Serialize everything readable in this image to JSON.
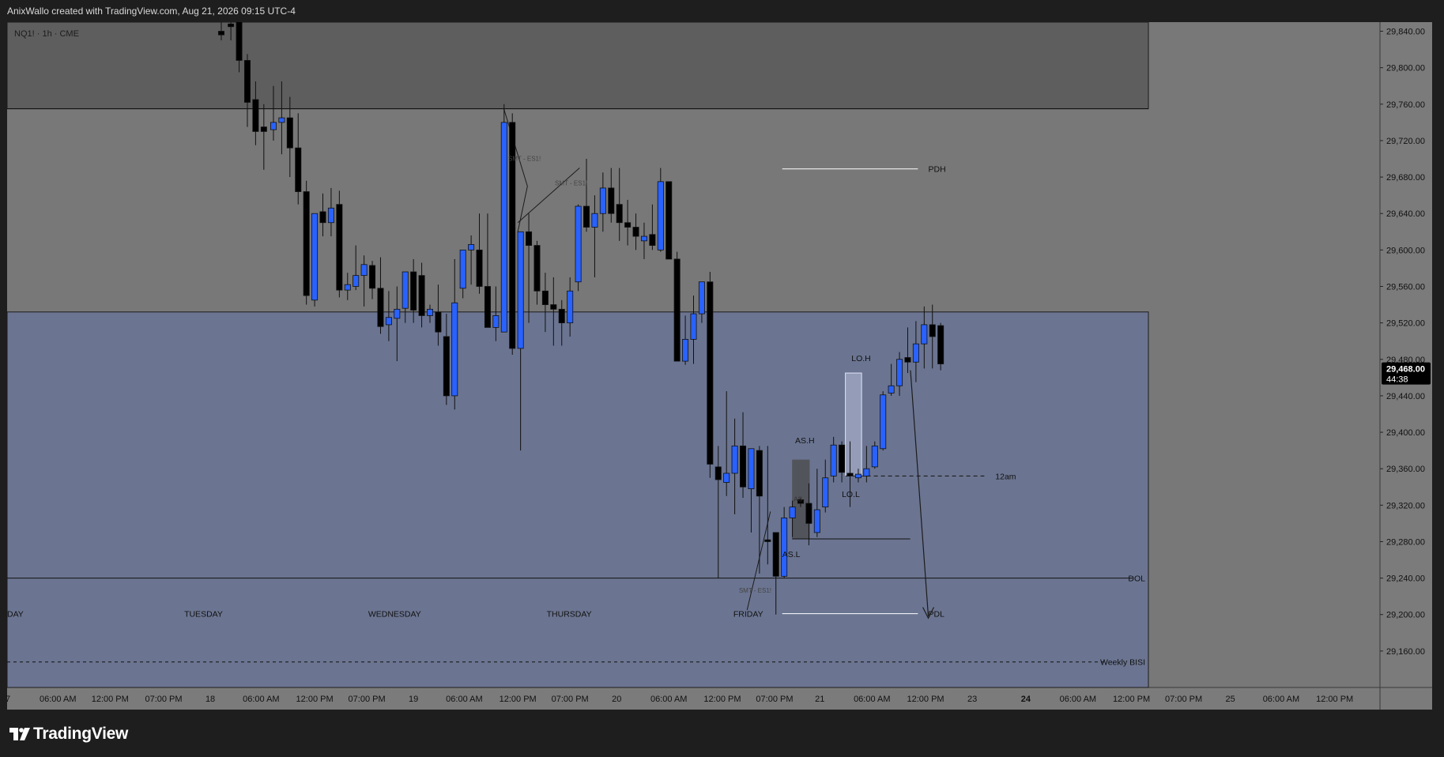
{
  "header": {
    "caption": "AnixWallo created with TradingView.com, Aug 21, 2026 09:15 UTC-4"
  },
  "symbol": "NQ1! · 1h · CME",
  "footer": {
    "brand": "TradingView"
  },
  "colors": {
    "bg": "#787878",
    "premium_zone": "#5e5e5e",
    "discount_zone": "#6b7591",
    "bull": "#2962ff",
    "bear": "#000000",
    "axis_bg": "#7b7b7b",
    "frame": "#1e1e1e"
  },
  "chart_data": {
    "type": "candlestick",
    "instrument": "NQ1!",
    "timeframe": "1h",
    "exchange": "CME",
    "ylim": [
      29120,
      29850
    ],
    "y_ticks": [
      29160,
      29200,
      29240,
      29280,
      29320,
      29360,
      29400,
      29440,
      29480,
      29520,
      29560,
      29600,
      29640,
      29680,
      29720,
      29760,
      29800,
      29840
    ],
    "y_tick_labels": [
      "29,160.00",
      "29,200.00",
      "29,240.00",
      "29,280.00",
      "29,320.00",
      "29,360.00",
      "29,400.00",
      "29,440.00",
      "29,480.00",
      "29,520.00",
      "29,560.00",
      "29,600.00",
      "29,640.00",
      "29,680.00",
      "29,720.00",
      "29,760.00",
      "29,800.00",
      "29,840.00"
    ],
    "x_ticks": [
      {
        "label": "06:00 AM",
        "x": 0.037
      },
      {
        "label": "12:00 PM",
        "x": 0.075
      },
      {
        "label": "07:00 PM",
        "x": 0.114
      },
      {
        "label": "18",
        "x": 0.148
      },
      {
        "label": "06:00 AM",
        "x": 0.185
      },
      {
        "label": "12:00 PM",
        "x": 0.224
      },
      {
        "label": "07:00 PM",
        "x": 0.262
      },
      {
        "label": "19",
        "x": 0.296
      },
      {
        "label": "06:00 AM",
        "x": 0.333
      },
      {
        "label": "12:00 PM",
        "x": 0.372
      },
      {
        "label": "07:00 PM",
        "x": 0.41
      },
      {
        "label": "20",
        "x": 0.444
      },
      {
        "label": "06:00 AM",
        "x": 0.482
      },
      {
        "label": "12:00 PM",
        "x": 0.521
      },
      {
        "label": "07:00 PM",
        "x": 0.559
      },
      {
        "label": "21",
        "x": 0.592
      },
      {
        "label": "06:00 AM",
        "x": 0.63
      },
      {
        "label": "12:00 PM",
        "x": 0.669
      },
      {
        "label": "23",
        "x": 0.703
      },
      {
        "label": "24",
        "x": 0.742
      },
      {
        "label": "06:00 AM",
        "x": 0.78
      },
      {
        "label": "12:00 PM",
        "x": 0.819
      },
      {
        "label": "07:00 PM",
        "x": 0.857
      },
      {
        "label": "25",
        "x": 0.891
      },
      {
        "label": "06:00 AM",
        "x": 0.928
      },
      {
        "label": "12:00 PM",
        "x": 0.967
      }
    ],
    "candles": [
      {
        "x": 0.156,
        "o": 29840,
        "h": 29850,
        "l": 29830,
        "c": 29836
      },
      {
        "x": 0.163,
        "o": 29848,
        "h": 29850,
        "l": 29830,
        "c": 29845
      },
      {
        "x": 0.169,
        "o": 29855,
        "h": 29858,
        "l": 29795,
        "c": 29808
      },
      {
        "x": 0.175,
        "o": 29808,
        "h": 29815,
        "l": 29735,
        "c": 29762
      },
      {
        "x": 0.181,
        "o": 29765,
        "h": 29785,
        "l": 29715,
        "c": 29730
      },
      {
        "x": 0.187,
        "o": 29735,
        "h": 29760,
        "l": 29688,
        "c": 29730
      },
      {
        "x": 0.194,
        "o": 29732,
        "h": 29780,
        "l": 29720,
        "c": 29740
      },
      {
        "x": 0.2,
        "o": 29740,
        "h": 29785,
        "l": 29705,
        "c": 29745
      },
      {
        "x": 0.206,
        "o": 29745,
        "h": 29768,
        "l": 29680,
        "c": 29712
      },
      {
        "x": 0.212,
        "o": 29712,
        "h": 29750,
        "l": 29650,
        "c": 29664
      },
      {
        "x": 0.218,
        "o": 29664,
        "h": 29676,
        "l": 29540,
        "c": 29550
      },
      {
        "x": 0.224,
        "o": 29545,
        "h": 29640,
        "l": 29538,
        "c": 29640
      },
      {
        "x": 0.23,
        "o": 29642,
        "h": 29662,
        "l": 29615,
        "c": 29630
      },
      {
        "x": 0.236,
        "o": 29630,
        "h": 29668,
        "l": 29615,
        "c": 29646
      },
      {
        "x": 0.242,
        "o": 29650,
        "h": 29665,
        "l": 29548,
        "c": 29556
      },
      {
        "x": 0.248,
        "o": 29556,
        "h": 29575,
        "l": 29545,
        "c": 29562
      },
      {
        "x": 0.254,
        "o": 29560,
        "h": 29605,
        "l": 29556,
        "c": 29572
      },
      {
        "x": 0.26,
        "o": 29572,
        "h": 29594,
        "l": 29538,
        "c": 29584
      },
      {
        "x": 0.266,
        "o": 29583,
        "h": 29588,
        "l": 29546,
        "c": 29558
      },
      {
        "x": 0.272,
        "o": 29558,
        "h": 29592,
        "l": 29508,
        "c": 29516
      },
      {
        "x": 0.278,
        "o": 29518,
        "h": 29555,
        "l": 29500,
        "c": 29526
      },
      {
        "x": 0.284,
        "o": 29525,
        "h": 29560,
        "l": 29478,
        "c": 29535
      },
      {
        "x": 0.29,
        "o": 29536,
        "h": 29570,
        "l": 29520,
        "c": 29576
      },
      {
        "x": 0.296,
        "o": 29576,
        "h": 29590,
        "l": 29520,
        "c": 29534
      },
      {
        "x": 0.302,
        "o": 29572,
        "h": 29586,
        "l": 29515,
        "c": 29528
      },
      {
        "x": 0.308,
        "o": 29528,
        "h": 29540,
        "l": 29520,
        "c": 29535
      },
      {
        "x": 0.314,
        "o": 29532,
        "h": 29562,
        "l": 29495,
        "c": 29510
      },
      {
        "x": 0.32,
        "o": 29505,
        "h": 29530,
        "l": 29430,
        "c": 29440
      },
      {
        "x": 0.326,
        "o": 29440,
        "h": 29590,
        "l": 29425,
        "c": 29542
      },
      {
        "x": 0.332,
        "o": 29558,
        "h": 29600,
        "l": 29547,
        "c": 29600
      },
      {
        "x": 0.338,
        "o": 29600,
        "h": 29616,
        "l": 29562,
        "c": 29606
      },
      {
        "x": 0.344,
        "o": 29600,
        "h": 29640,
        "l": 29552,
        "c": 29560
      },
      {
        "x": 0.35,
        "o": 29560,
        "h": 29640,
        "l": 29525,
        "c": 29515
      },
      {
        "x": 0.356,
        "o": 29515,
        "h": 29560,
        "l": 29500,
        "c": 29528
      },
      {
        "x": 0.362,
        "o": 29510,
        "h": 29760,
        "l": 29524,
        "c": 29740
      },
      {
        "x": 0.368,
        "o": 29740,
        "h": 29750,
        "l": 29485,
        "c": 29492
      },
      {
        "x": 0.374,
        "o": 29492,
        "h": 29620,
        "l": 29380,
        "c": 29620
      },
      {
        "x": 0.38,
        "o": 29620,
        "h": 29640,
        "l": 29520,
        "c": 29605
      },
      {
        "x": 0.386,
        "o": 29605,
        "h": 29610,
        "l": 29540,
        "c": 29555
      },
      {
        "x": 0.392,
        "o": 29555,
        "h": 29575,
        "l": 29510,
        "c": 29540
      },
      {
        "x": 0.398,
        "o": 29540,
        "h": 29570,
        "l": 29495,
        "c": 29535
      },
      {
        "x": 0.404,
        "o": 29535,
        "h": 29545,
        "l": 29495,
        "c": 29520
      },
      {
        "x": 0.41,
        "o": 29520,
        "h": 29570,
        "l": 29505,
        "c": 29555
      },
      {
        "x": 0.416,
        "o": 29565,
        "h": 29650,
        "l": 29555,
        "c": 29648
      },
      {
        "x": 0.422,
        "o": 29648,
        "h": 29700,
        "l": 29620,
        "c": 29625
      },
      {
        "x": 0.428,
        "o": 29625,
        "h": 29660,
        "l": 29570,
        "c": 29640
      },
      {
        "x": 0.434,
        "o": 29640,
        "h": 29685,
        "l": 29620,
        "c": 29668
      },
      {
        "x": 0.44,
        "o": 29668,
        "h": 29690,
        "l": 29630,
        "c": 29640
      },
      {
        "x": 0.446,
        "o": 29650,
        "h": 29690,
        "l": 29610,
        "c": 29630
      },
      {
        "x": 0.452,
        "o": 29630,
        "h": 29655,
        "l": 29605,
        "c": 29625
      },
      {
        "x": 0.458,
        "o": 29625,
        "h": 29640,
        "l": 29600,
        "c": 29615
      },
      {
        "x": 0.464,
        "o": 29610,
        "h": 29630,
        "l": 29590,
        "c": 29615
      },
      {
        "x": 0.47,
        "o": 29617,
        "h": 29650,
        "l": 29600,
        "c": 29605
      },
      {
        "x": 0.476,
        "o": 29600,
        "h": 29690,
        "l": 29598,
        "c": 29675
      },
      {
        "x": 0.482,
        "o": 29675,
        "h": 29675,
        "l": 29590,
        "c": 29590
      },
      {
        "x": 0.488,
        "o": 29590,
        "h": 29598,
        "l": 29478,
        "c": 29478
      },
      {
        "x": 0.494,
        "o": 29478,
        "h": 29528,
        "l": 29474,
        "c": 29502
      },
      {
        "x": 0.5,
        "o": 29502,
        "h": 29550,
        "l": 29475,
        "c": 29530
      },
      {
        "x": 0.506,
        "o": 29530,
        "h": 29560,
        "l": 29520,
        "c": 29565
      },
      {
        "x": 0.512,
        "o": 29565,
        "h": 29576,
        "l": 29350,
        "c": 29365
      },
      {
        "x": 0.518,
        "o": 29362,
        "h": 29385,
        "l": 29240,
        "c": 29348
      },
      {
        "x": 0.524,
        "o": 29345,
        "h": 29445,
        "l": 29330,
        "c": 29355
      },
      {
        "x": 0.53,
        "o": 29355,
        "h": 29415,
        "l": 29310,
        "c": 29385
      },
      {
        "x": 0.536,
        "o": 29385,
        "h": 29422,
        "l": 29328,
        "c": 29340
      },
      {
        "x": 0.542,
        "o": 29338,
        "h": 29375,
        "l": 29290,
        "c": 29382
      },
      {
        "x": 0.548,
        "o": 29380,
        "h": 29385,
        "l": 29245,
        "c": 29330
      },
      {
        "x": 0.554,
        "o": 29282,
        "h": 29385,
        "l": 29255,
        "c": 29280
      },
      {
        "x": 0.56,
        "o": 29290,
        "h": 29290,
        "l": 29200,
        "c": 29242
      },
      {
        "x": 0.566,
        "o": 29242,
        "h": 29318,
        "l": 29240,
        "c": 29306
      },
      {
        "x": 0.572,
        "o": 29306,
        "h": 29325,
        "l": 29285,
        "c": 29318
      },
      {
        "x": 0.578,
        "o": 29326,
        "h": 29328,
        "l": 29318,
        "c": 29322
      },
      {
        "x": 0.584,
        "o": 29322,
        "h": 29344,
        "l": 29276,
        "c": 29300
      },
      {
        "x": 0.59,
        "o": 29290,
        "h": 29360,
        "l": 29285,
        "c": 29315
      },
      {
        "x": 0.596,
        "o": 29318,
        "h": 29370,
        "l": 29312,
        "c": 29350
      },
      {
        "x": 0.602,
        "o": 29352,
        "h": 29395,
        "l": 29345,
        "c": 29386
      },
      {
        "x": 0.608,
        "o": 29386,
        "h": 29390,
        "l": 29345,
        "c": 29356
      },
      {
        "x": 0.614,
        "o": 29355,
        "h": 29390,
        "l": 29318,
        "c": 29352
      },
      {
        "x": 0.62,
        "o": 29350,
        "h": 29360,
        "l": 29345,
        "c": 29354
      },
      {
        "x": 0.626,
        "o": 29352,
        "h": 29385,
        "l": 29345,
        "c": 29360
      },
      {
        "x": 0.632,
        "o": 29362,
        "h": 29390,
        "l": 29360,
        "c": 29385
      },
      {
        "x": 0.638,
        "o": 29382,
        "h": 29445,
        "l": 29380,
        "c": 29441
      },
      {
        "x": 0.644,
        "o": 29443,
        "h": 29475,
        "l": 29440,
        "c": 29451
      },
      {
        "x": 0.65,
        "o": 29451,
        "h": 29488,
        "l": 29440,
        "c": 29480
      },
      {
        "x": 0.656,
        "o": 29482,
        "h": 29515,
        "l": 29465,
        "c": 29477
      },
      {
        "x": 0.662,
        "o": 29477,
        "h": 29522,
        "l": 29455,
        "c": 29497
      },
      {
        "x": 0.668,
        "o": 29497,
        "h": 29538,
        "l": 29470,
        "c": 29518
      },
      {
        "x": 0.674,
        "o": 29518,
        "h": 29540,
        "l": 29470,
        "c": 29505
      },
      {
        "x": 0.68,
        "o": 29517,
        "h": 29520,
        "l": 29468,
        "c": 29475
      }
    ],
    "levels": [
      {
        "label": "PDH",
        "value": 29689
      },
      {
        "label": "PDL",
        "value": 29201
      },
      {
        "label": "12am",
        "value": 29352
      },
      {
        "label": "DOL",
        "value": 29240
      },
      {
        "label": "Weekly BISI",
        "value": 29148
      }
    ],
    "annotations": [
      {
        "text": "SMT - ES1!"
      },
      {
        "text": "SMT - ES1!"
      },
      {
        "text": "SMT - ES1!"
      },
      {
        "text": "AS.H"
      },
      {
        "text": "AS.L"
      },
      {
        "text": "LO.H"
      },
      {
        "text": "LO.L"
      },
      {
        "text": "AS"
      }
    ],
    "day_labels": [
      "DAY",
      "TUESDAY",
      "WEDNESDAY",
      "THURSDAY",
      "FRIDAY"
    ],
    "zones": {
      "premium_top": 29850,
      "premium_bottom": 29755,
      "equilibrium": 29532,
      "discount_bottom": 29120
    },
    "current_price": {
      "value_label": "29,468.00",
      "countdown": "44:38",
      "value": 29468
    },
    "grid": false,
    "legend": "none"
  }
}
